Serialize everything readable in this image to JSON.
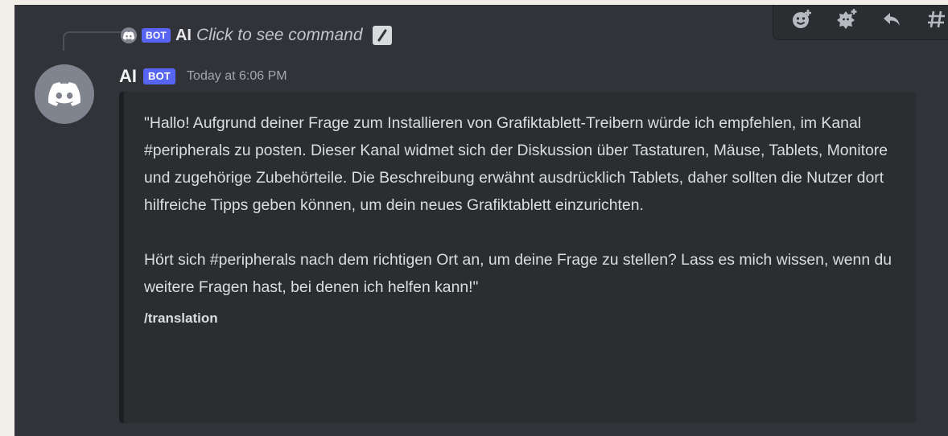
{
  "reply": {
    "bot_tag": "BOT",
    "author": "AI",
    "command_hint": "Click to see command"
  },
  "toolbar": {
    "icons": [
      "add-reaction-icon",
      "add-super-reaction-icon",
      "reply-icon",
      "create-thread-icon"
    ]
  },
  "message": {
    "author": "AI",
    "bot_tag": "BOT",
    "timestamp": "Today at 6:06 PM",
    "embed": {
      "paragraphs": [
        "\"Hallo! Aufgrund deiner Frage zum Installieren von Grafiktablett-Treibern würde ich empfehlen, im Kanal #peripherals zu posten. Dieser Kanal widmet sich der Diskussion über Tastaturen, Mäuse, Tablets, Monitore und zugehörige Zubehörteile. Die Beschreibung erwähnt ausdrücklich Tablets, daher sollten die Nutzer dort hilfreiche Tipps geben können, um dein neues Grafiktablett einzurichten.",
        "Hört sich #peripherals nach dem richtigen Ort an, um deine Frage zu stellen? Lass es mich wissen, wenn du weitere Fragen hast, bei denen ich helfen kann!\""
      ],
      "footer": "/translation"
    }
  },
  "colors": {
    "background": "#313338",
    "embed_background": "#2b2d31",
    "bot_tag": "#5865f2",
    "text": "#dbdee1",
    "muted": "#a4a6ad"
  }
}
